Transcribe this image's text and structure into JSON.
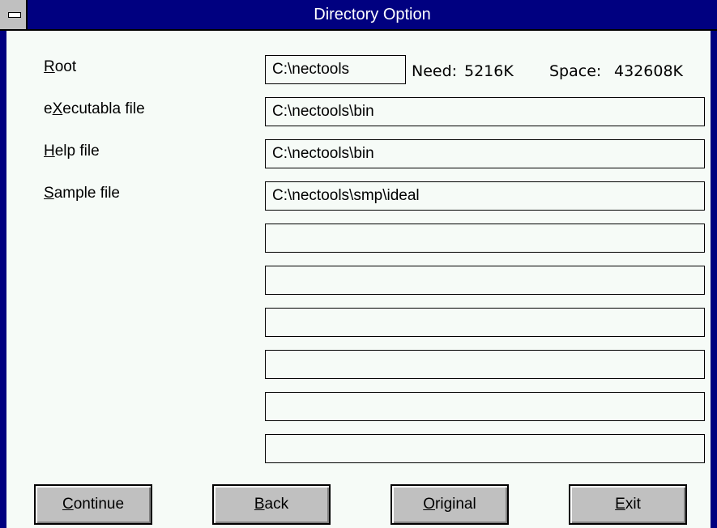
{
  "window": {
    "title": "Directory Option"
  },
  "labels": {
    "root": {
      "mnemonic": "R",
      "rest": "oot"
    },
    "executable": {
      "pre": "e",
      "mnemonic": "X",
      "rest": "ecutabla file"
    },
    "help": {
      "mnemonic": "H",
      "rest": "elp file"
    },
    "sample": {
      "mnemonic": "S",
      "rest": "ample file"
    }
  },
  "fields": {
    "root": "C:\\nectools",
    "executable": "C:\\nectools\\bin",
    "help": "C:\\nectools\\bin",
    "sample": "C:\\nectools\\smp\\ideal",
    "extra": [
      "",
      "",
      "",
      "",
      "",
      ""
    ]
  },
  "info": {
    "need_label": "Need:",
    "need_value": "5216K",
    "space_label": "Space:",
    "space_value": "432608K"
  },
  "buttons": {
    "continue": {
      "mnemonic": "C",
      "rest": "ontinue"
    },
    "back": {
      "mnemonic": "B",
      "rest": "ack"
    },
    "original": {
      "mnemonic": "O",
      "rest": "riginal"
    },
    "exit": {
      "mnemonic": "E",
      "rest": "xit"
    }
  }
}
